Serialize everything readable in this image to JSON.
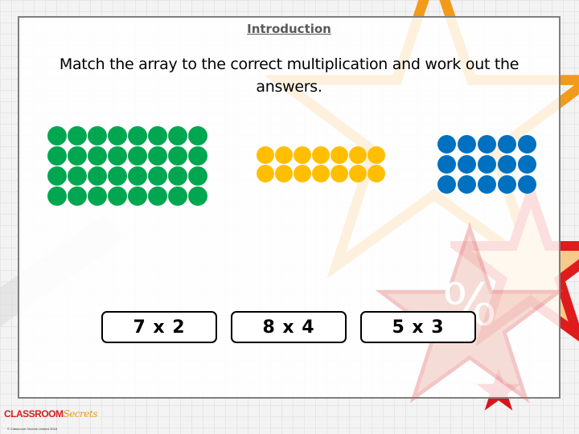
{
  "slide": {
    "heading": "Introduction",
    "instruction": "Match the array to the correct multiplication and work out the answers."
  },
  "arrays": [
    {
      "name": "green-array",
      "rows": 4,
      "columns": 8,
      "color": "#00a650"
    },
    {
      "name": "yellow-array",
      "rows": 2,
      "columns": 7,
      "color": "#ffbf00"
    },
    {
      "name": "blue-array",
      "rows": 3,
      "columns": 5,
      "color": "#0070c0"
    }
  ],
  "cards": [
    {
      "label": "7 x 2"
    },
    {
      "label": "8 x 4"
    },
    {
      "label": "5 x 3"
    }
  ],
  "branding": {
    "logo_part1": "CLASSROOM",
    "logo_part2": "Secrets",
    "copyright": "© Classroom Secrets Limited 2018"
  }
}
